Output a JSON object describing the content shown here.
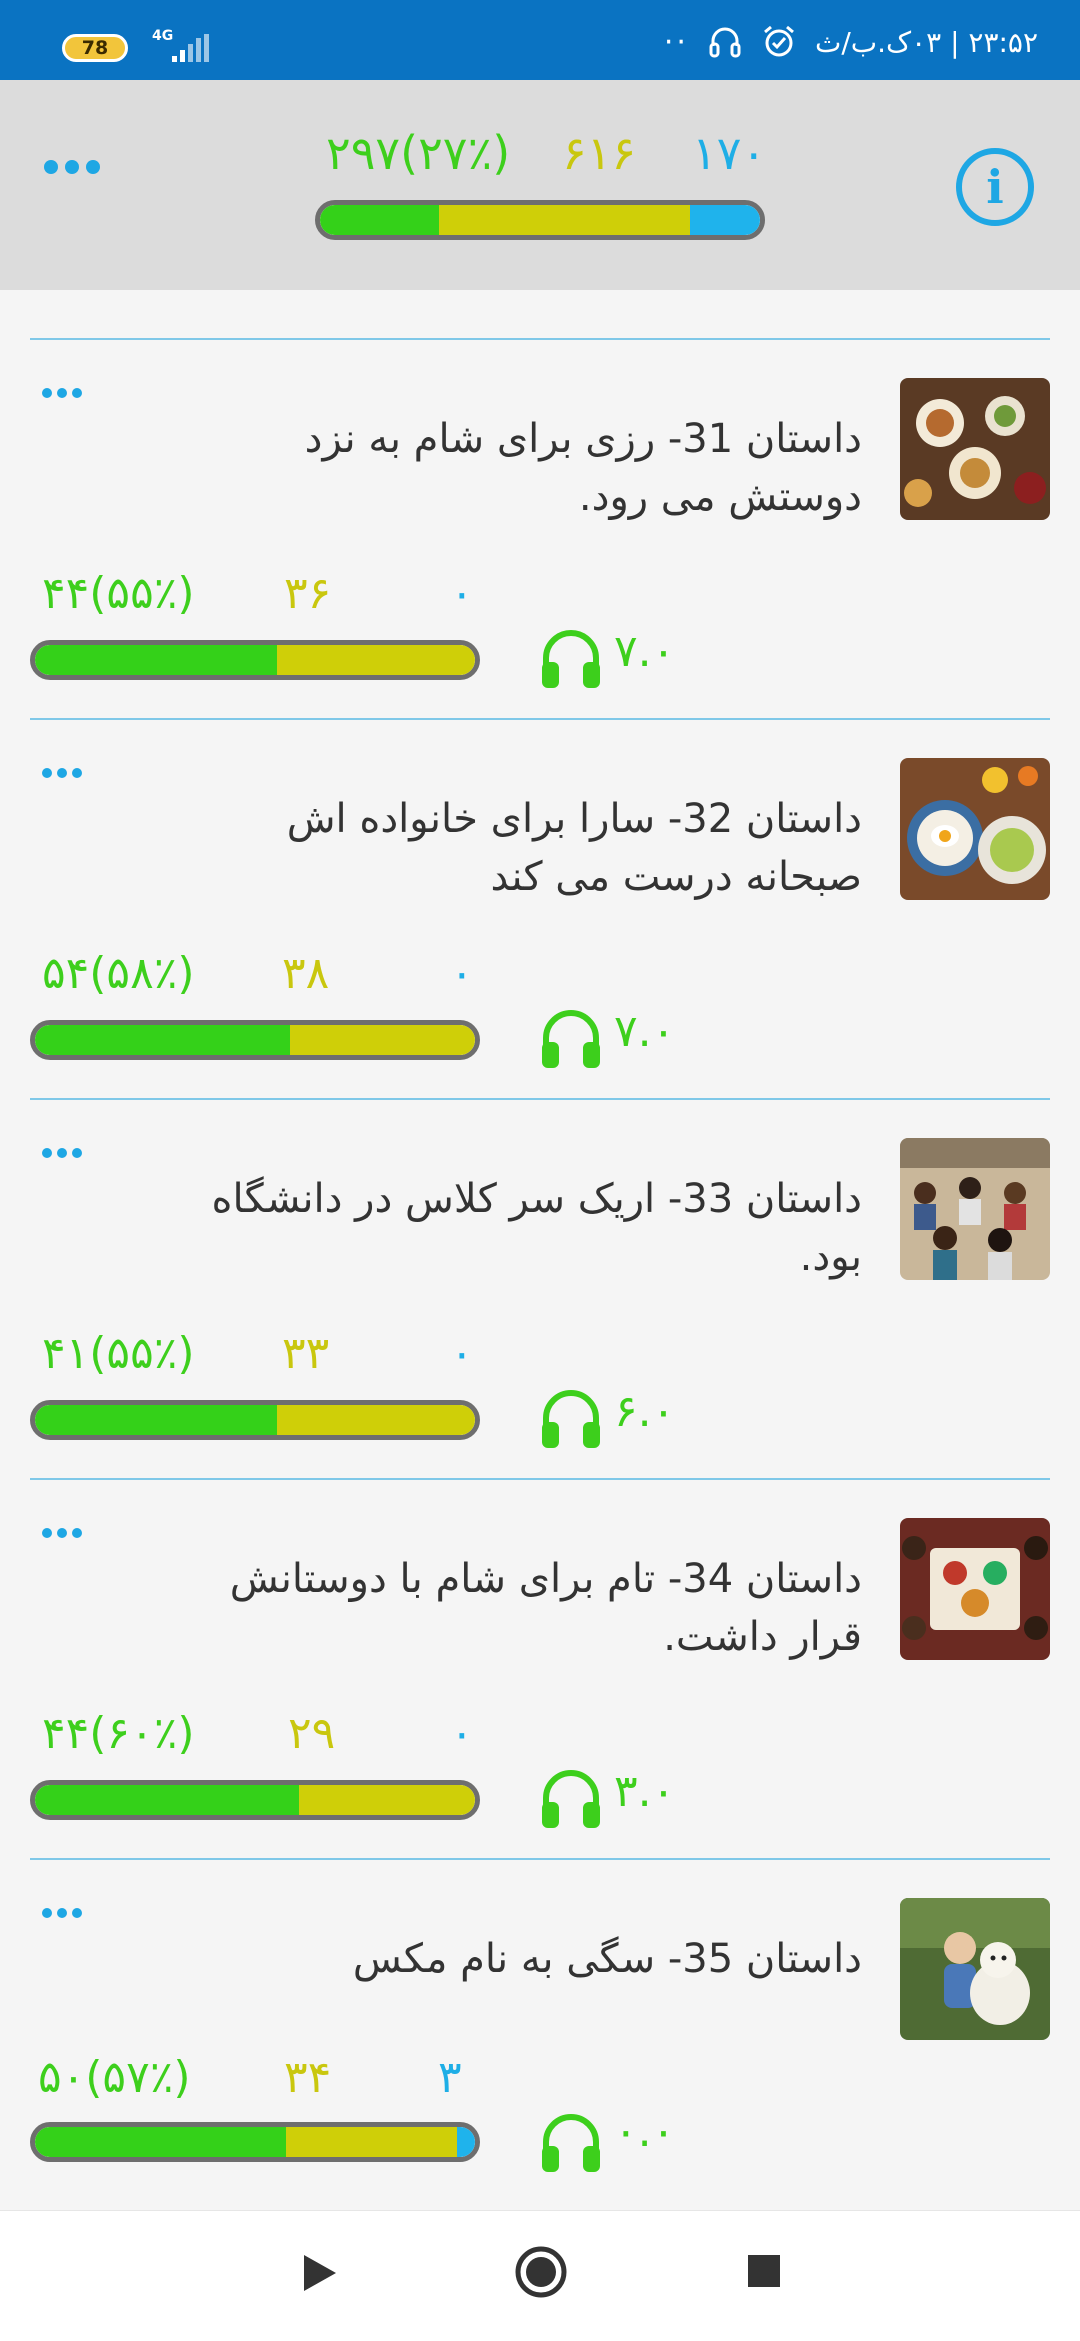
{
  "status_bar": {
    "battery": "78",
    "network": "4G",
    "dots": "··",
    "datetime": "۲۳:۵۲ | ۰۳ک.ب/ث"
  },
  "header": {
    "stats": {
      "green": "۲۹۷(۲۷٪)",
      "yellow": "۶۱۶",
      "blue": "۱۷۰"
    },
    "progress": {
      "green": 0.27,
      "yellow": 0.57,
      "blue": 0.16
    },
    "info_label": "i"
  },
  "items": [
    {
      "title": "داستان 31- رزی برای شام به نزد دوستش می رود.",
      "image": "dinner-table-photo",
      "green": "۴۴(۵۵٪)",
      "yellow": "۳۶",
      "blue": "۰",
      "duration": "۷.۰",
      "progress": {
        "green": 0.55,
        "yellow": 0.45,
        "blue": 0
      }
    },
    {
      "title": "داستان 32- سارا برای خانواده اش صبحانه درست می کند",
      "image": "breakfast-plates-photo",
      "green": "۵۴(۵۸٪)",
      "yellow": "۳۸",
      "blue": "۰",
      "duration": "۷.۰",
      "progress": {
        "green": 0.58,
        "yellow": 0.42,
        "blue": 0
      }
    },
    {
      "title": "داستان 33- اریک سر کلاس در دانشگاه بود.",
      "image": "classroom-photo",
      "green": "۴۱(۵۵٪)",
      "yellow": "۳۳",
      "blue": "۰",
      "duration": "۶.۰",
      "progress": {
        "green": 0.55,
        "yellow": 0.45,
        "blue": 0
      }
    },
    {
      "title": "داستان 34- تام برای شام با دوستانش قرار داشت.",
      "image": "dinner-friends-photo",
      "green": "۴۴(۶۰٪)",
      "yellow": "۲۹",
      "blue": "۰",
      "duration": "۳.۰",
      "progress": {
        "green": 0.6,
        "yellow": 0.4,
        "blue": 0
      }
    },
    {
      "title": "داستان 35- سگی به نام مکس",
      "image": "boy-with-dog-photo",
      "green": "۵۰(۵۷٪)",
      "yellow": "۳۴",
      "blue": "۳",
      "duration": "۰.۰",
      "progress": {
        "green": 0.57,
        "yellow": 0.39,
        "blue": 0.04
      }
    }
  ],
  "navbar": {
    "icons": [
      "play-icon",
      "home-circle-icon",
      "stop-icon"
    ]
  }
}
